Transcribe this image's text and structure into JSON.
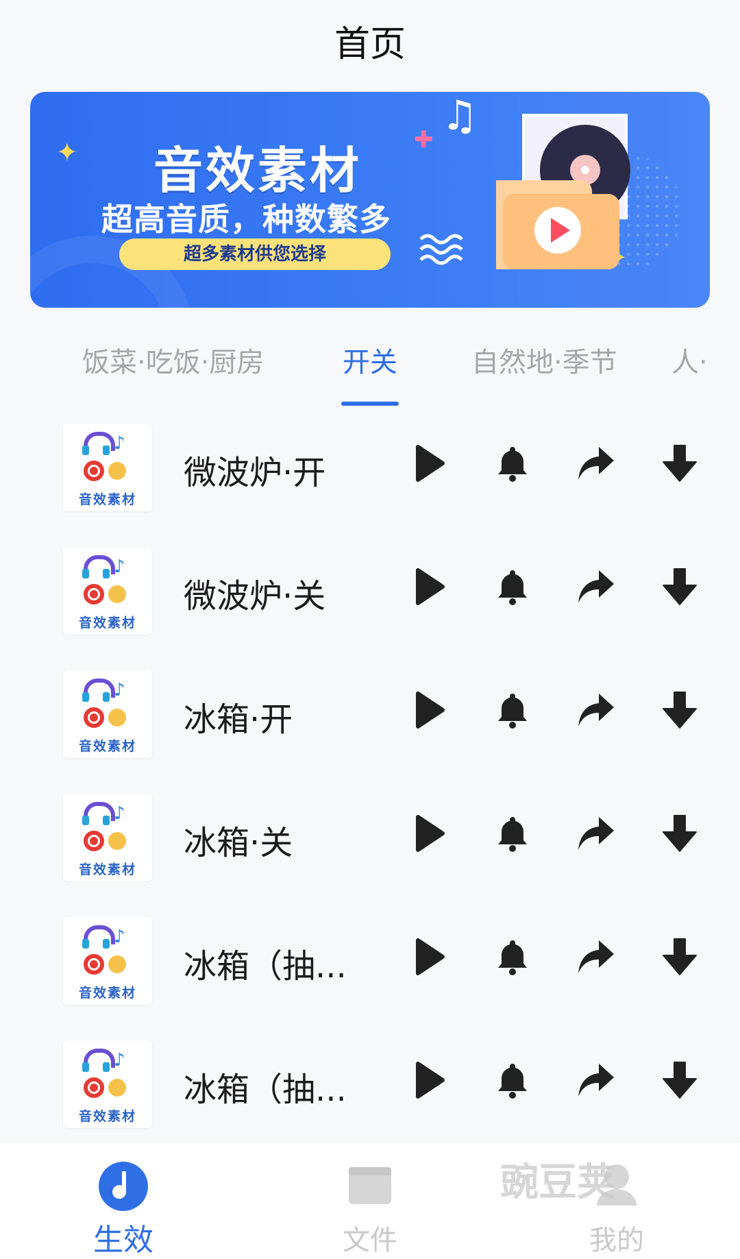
{
  "header": {
    "title": "首页"
  },
  "banner": {
    "headline": "音效素材",
    "subline": "超高音质，种数繁多",
    "pill": "超多素材供您选择"
  },
  "tabs": [
    {
      "label": "饭菜·吃饭·厨房",
      "active": false
    },
    {
      "label": "开关",
      "active": true
    },
    {
      "label": "自然地·季节",
      "active": false
    },
    {
      "label": "人·",
      "active": false
    }
  ],
  "thumb_caption": "音效素材",
  "items": [
    {
      "name": "微波炉·开"
    },
    {
      "name": "微波炉·关"
    },
    {
      "name": "冰箱·开"
    },
    {
      "name": "冰箱·关"
    },
    {
      "name": "冰箱（抽..."
    },
    {
      "name": "冰箱（抽..."
    }
  ],
  "actions": [
    "play-icon",
    "bell-icon",
    "share-icon",
    "download-icon"
  ],
  "bottom_nav": [
    {
      "label": "生效",
      "icon": "music-disc-icon",
      "active": true
    },
    {
      "label": "文件",
      "icon": "folder-icon",
      "active": false
    },
    {
      "label": "我的",
      "icon": "user-icon",
      "active": false
    }
  ],
  "watermark": "豌豆荚",
  "colors": {
    "accent": "#2f6fe6",
    "banner": "#3474f2",
    "icon": "#222222",
    "inactive": "#c9c9c9"
  }
}
